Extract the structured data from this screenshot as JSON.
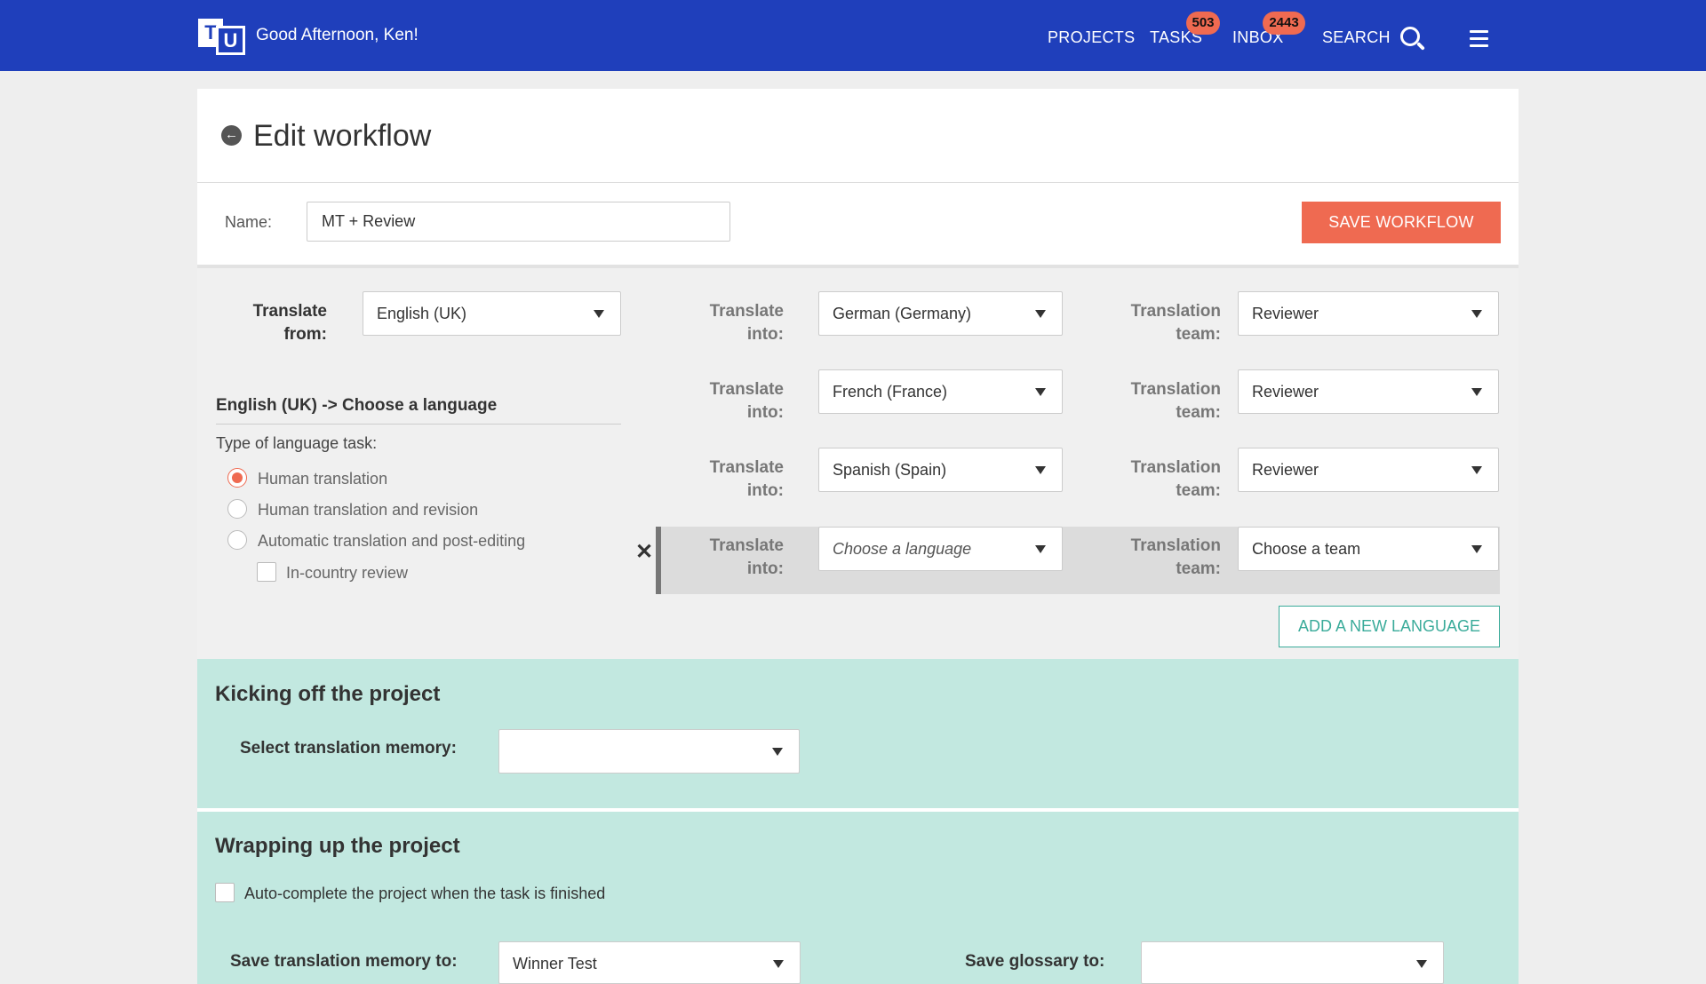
{
  "header": {
    "logo_t": "T",
    "logo_u": "U",
    "greeting": "Good Afternoon, Ken!",
    "nav": {
      "projects": "PROJECTS",
      "tasks": "TASKS",
      "tasks_badge": "503",
      "inbox": "INBOX",
      "inbox_badge": "2443",
      "search": "SEARCH"
    }
  },
  "page": {
    "title": "Edit workflow",
    "name_label": "Name:",
    "name_value": "MT + Review",
    "save_label": "SAVE WORKFLOW"
  },
  "languages": {
    "translate_from_label_1": "Translate",
    "translate_from_label_2": "from:",
    "source_language": "English (UK)",
    "translate_into_label_1": "Translate",
    "translate_into_label_2": "into:",
    "team_label_1": "Translation",
    "team_label_2": "team:",
    "targets": [
      {
        "language": "German (Germany)",
        "team": "Reviewer"
      },
      {
        "language": "French (France)",
        "team": "Reviewer"
      },
      {
        "language": "Spanish (Spain)",
        "team": "Reviewer"
      },
      {
        "language": "Choose a language",
        "team": "Choose a team"
      }
    ],
    "pair_title": "English (UK) -> Choose a language",
    "task_type_label": "Type of language task:",
    "task_options": [
      {
        "label": "Human translation",
        "checked": true
      },
      {
        "label": "Human translation and revision",
        "checked": false
      },
      {
        "label": "Automatic translation and post-editing",
        "checked": false
      }
    ],
    "in_country_review": "In-country review",
    "remove_symbol": "✕",
    "add_language_label": "ADD A NEW LANGUAGE"
  },
  "kickoff": {
    "title": "Kicking off the project",
    "tm_label": "Select translation memory:",
    "tm_value": ""
  },
  "wrapup": {
    "title": "Wrapping up the project",
    "autocomplete_label": "Auto-complete the project when the task is finished",
    "save_tm_label": "Save translation memory to:",
    "save_tm_value": "Winner Test",
    "save_glossary_label": "Save glossary to:",
    "save_glossary_value": ""
  },
  "colors": {
    "header_bg": "#1f3fbb",
    "accent": "#ef6a51",
    "teal_bg": "#c2e8e0",
    "teal_text": "#3aab9a"
  }
}
